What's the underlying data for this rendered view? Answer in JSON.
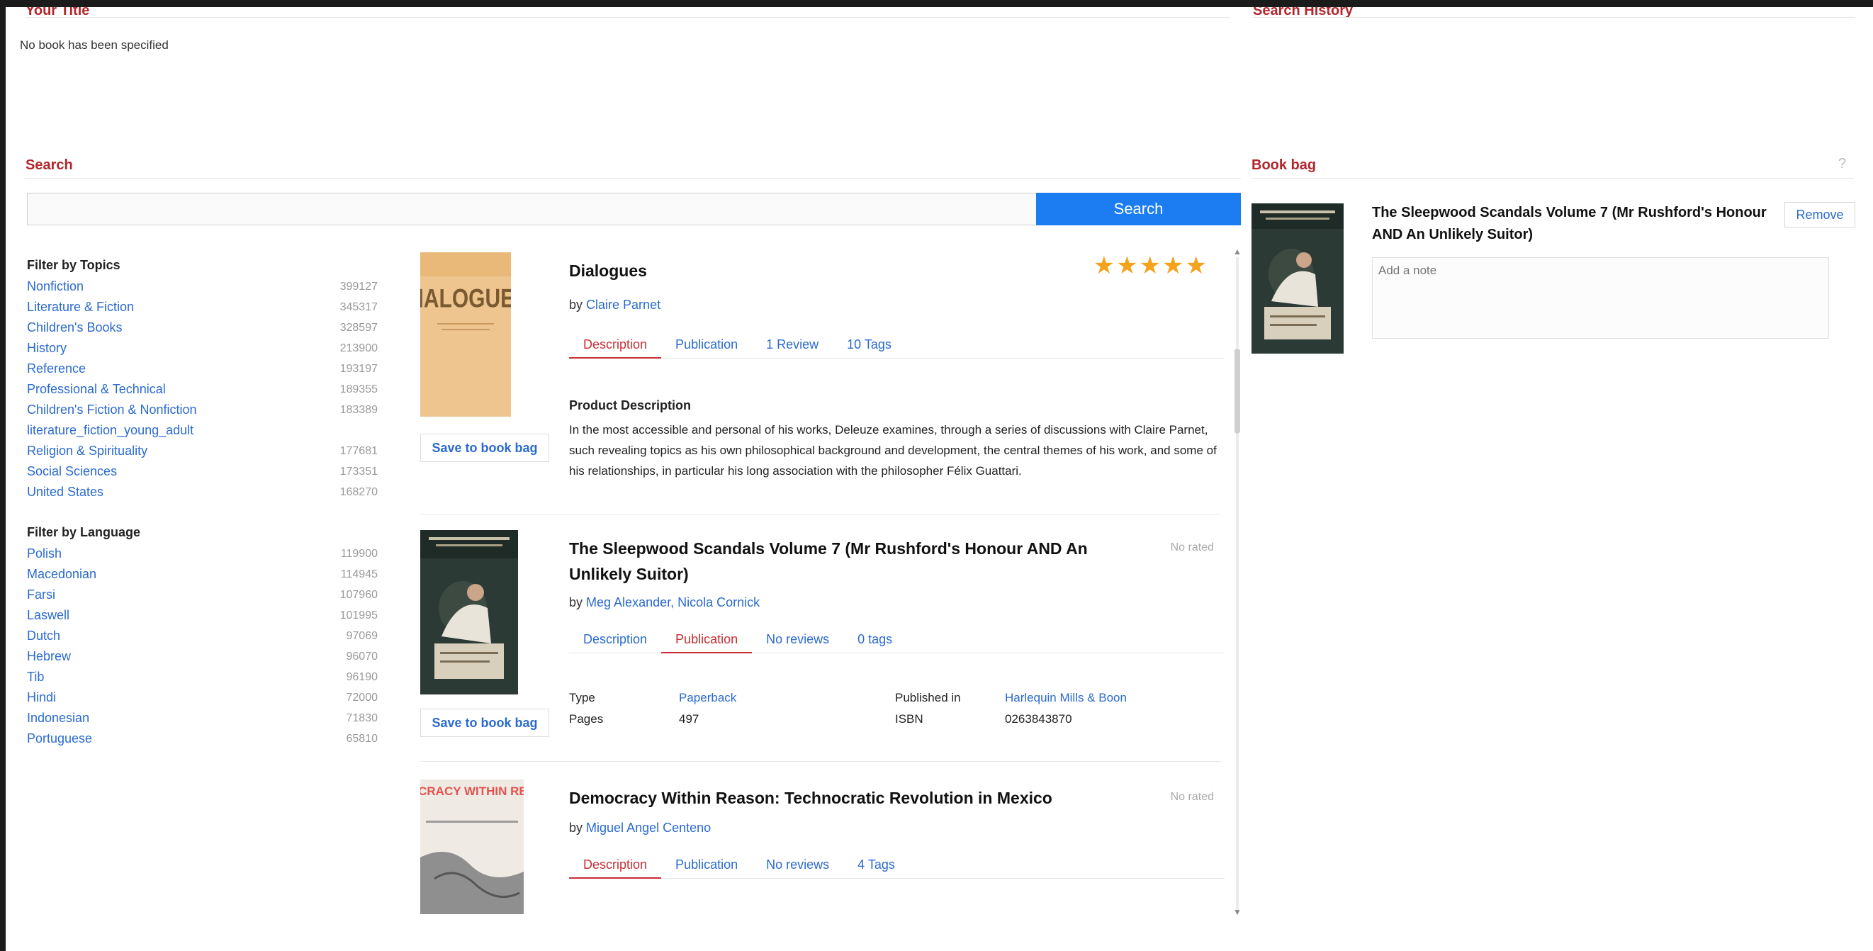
{
  "top": {
    "left_title": "Your Title",
    "right_title": "Search History",
    "no_book_message": "No book has been specified"
  },
  "search": {
    "title": "Search",
    "placeholder": "",
    "button_label": "Search"
  },
  "filters": {
    "topics_heading": "Filter by Topics",
    "topics": [
      {
        "name": "Nonfiction",
        "count": "399127"
      },
      {
        "name": "Literature & Fiction",
        "count": "345317"
      },
      {
        "name": "Children's Books",
        "count": "328597"
      },
      {
        "name": "History",
        "count": "213900"
      },
      {
        "name": "Reference",
        "count": "193197"
      },
      {
        "name": "Professional & Technical",
        "count": "189355"
      },
      {
        "name": "Children's Fiction & Nonfiction",
        "count": "183389"
      },
      {
        "name": "literature_fiction_young_adult",
        "count": ""
      },
      {
        "name": "Religion & Spirituality",
        "count": "177681"
      },
      {
        "name": "Social Sciences",
        "count": "173351"
      },
      {
        "name": "United States",
        "count": "168270"
      }
    ],
    "language_heading": "Filter by Language",
    "languages": [
      {
        "name": "Polish",
        "count": "119900"
      },
      {
        "name": "Macedonian",
        "count": "114945"
      },
      {
        "name": "Farsi",
        "count": "107960"
      },
      {
        "name": "Laswell",
        "count": "101995"
      },
      {
        "name": "Dutch",
        "count": "97069"
      },
      {
        "name": "Hebrew",
        "count": "96070"
      },
      {
        "name": "Tib",
        "count": "96190"
      },
      {
        "name": "Hindi",
        "count": "72000"
      },
      {
        "name": "Indonesian",
        "count": "71830"
      },
      {
        "name": "Portuguese",
        "count": "65810"
      }
    ]
  },
  "results": [
    {
      "title": "Dialogues",
      "by": "by",
      "authors": "Claire Parnet",
      "save_label": "Save to book bag",
      "tabs": [
        "Description",
        "Publication",
        "1 Review",
        "10 Tags"
      ],
      "description_heading": "Product Description",
      "description": "In the most accessible and personal of his works, Deleuze examines, through a series of discussions with Claire Parnet, such revealing topics as his own philosophical background and development, the central themes of his work, and some of his relationships, in particular his long association with the philosopher Félix Guattari.",
      "rating_stars": 5,
      "cover_text": "DIALOGUES",
      "cover_color": "#eec48f"
    },
    {
      "title": "The Sleepwood Scandals Volume 7 (Mr Rushford's Honour AND An Unlikely Suitor)",
      "by": "by",
      "authors": "Meg Alexander, Nicola Cornick",
      "meta": "No rated",
      "save_label": "Save to book bag",
      "tabs": [
        "Description",
        "Publication",
        "No reviews",
        "0 tags"
      ],
      "publication": {
        "type_label": "Type",
        "type_value": "Paperback",
        "pages_label": "Pages",
        "pages_value": "497",
        "published_label": "Published in",
        "published_value": "Harlequin Mills & Boon",
        "isbn_label": "ISBN",
        "isbn_value": "0263843870"
      }
    },
    {
      "title": "Democracy Within Reason: Technocratic Revolution in Mexico",
      "by": "by",
      "authors": "Miguel Angel Centeno",
      "meta": "No rated",
      "tabs": [
        "Description",
        "Publication",
        "No reviews",
        "4 Tags"
      ],
      "cover_text": "DEMOCRACY WITHIN REASON",
      "cover_color": "#e4524c"
    }
  ],
  "book_bag": {
    "title": "Book bag",
    "help": "?",
    "item_title": "The Sleepwood Scandals Volume 7 (Mr Rushford's Honour AND An Unlikely Suitor)",
    "remove_label": "Remove",
    "notes_placeholder": "Add a note"
  }
}
